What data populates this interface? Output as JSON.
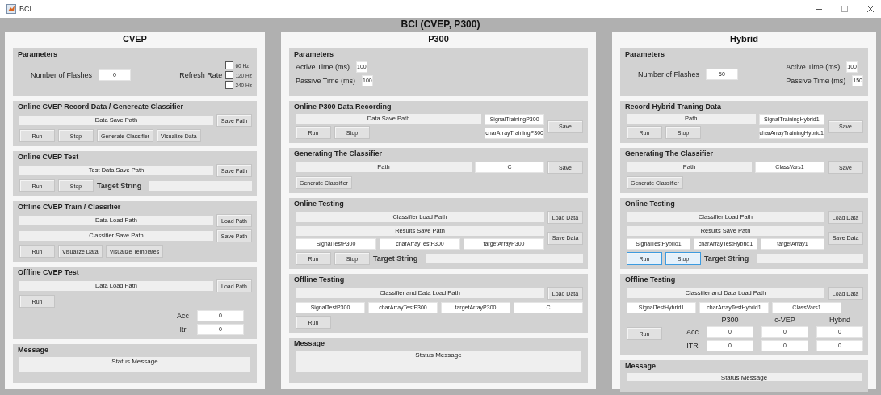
{
  "window": {
    "title": "BCI"
  },
  "header": "BCI (CVEP, P300)",
  "columns": [
    {
      "title": "CVEP",
      "panels": [
        {
          "kind": "params",
          "title": "Parameters",
          "lines": [
            [
              {
                "kind": "field",
                "label": "Number of Flashes",
                "value": "0"
              },
              {
                "kind": "checks",
                "label": "Refresh Rate",
                "options": [
                  {
                    "label": "60 Hz",
                    "checked": false
                  },
                  {
                    "label": "120 Hz",
                    "checked": false
                  },
                  {
                    "label": "240 Hz",
                    "checked": false
                  }
                ]
              }
            ]
          ]
        },
        {
          "kind": "form",
          "title": "Online CVEP Record Data / Genereate Classifier",
          "lines": [
            [
              {
                "kind": "path",
                "text": "Data Save Path"
              },
              {
                "kind": "button",
                "text": "Save Path",
                "highlighted": false
              }
            ],
            [
              {
                "kind": "button",
                "text": "Run",
                "highlighted": false
              },
              {
                "kind": "button",
                "text": "Stop",
                "highlighted": false
              },
              {
                "kind": "button",
                "text": "Generate Classifier",
                "highlighted": false
              },
              {
                "kind": "button",
                "text": "Visualize Data",
                "highlighted": false
              }
            ]
          ]
        },
        {
          "kind": "form",
          "title": "Online CVEP Test",
          "lines": [
            [
              {
                "kind": "path",
                "text": "Test Data Save Path"
              },
              {
                "kind": "button",
                "text": "Save Path",
                "highlighted": false
              }
            ],
            [
              {
                "kind": "button",
                "text": "Run",
                "highlighted": false
              },
              {
                "kind": "button",
                "text": "Stop",
                "highlighted": false
              },
              {
                "kind": "label",
                "text": "Target String"
              },
              {
                "kind": "input"
              }
            ]
          ]
        },
        {
          "kind": "form",
          "title": "Offline CVEP Train  / Classifier",
          "lines": [
            [
              {
                "kind": "path",
                "text": "Data Load Path"
              },
              {
                "kind": "button",
                "text": "Load Path",
                "highlighted": false
              }
            ],
            [
              {
                "kind": "path",
                "text": "Classifier Save Path"
              },
              {
                "kind": "button",
                "text": "Save Path",
                "highlighted": false
              }
            ],
            [
              {
                "kind": "button",
                "text": "Run",
                "highlighted": false
              },
              {
                "kind": "button",
                "text": "Visualize Data",
                "highlighted": false
              },
              {
                "kind": "button",
                "text": "Visualize Templates",
                "highlighted": false
              }
            ]
          ]
        },
        {
          "kind": "form",
          "title": "Offline CVEP Test",
          "lines": [
            [
              {
                "kind": "path",
                "text": "Data Load Path"
              },
              {
                "kind": "button",
                "text": "Load Path",
                "highlighted": false
              }
            ],
            [
              {
                "kind": "button",
                "text": "Run",
                "highlighted": false
              }
            ],
            [
              {
                "kind": "table",
                "rows": [
                  {
                    "label": "Acc",
                    "values": [
                      "0"
                    ]
                  },
                  {
                    "label": "Itr",
                    "values": [
                      "0"
                    ]
                  }
                ]
              }
            ]
          ]
        },
        {
          "kind": "message",
          "title": "Message",
          "text": "Status Message"
        }
      ]
    },
    {
      "title": "P300",
      "panels": [
        {
          "kind": "params",
          "title": "Parameters",
          "lines": [
            [
              {
                "kind": "stack",
                "lines": [
                  [
                    {
                      "kind": "field",
                      "label": "Active Time (ms)",
                      "value": "100"
                    }
                  ],
                  [
                    {
                      "kind": "field",
                      "label": "Passive Time (ms)",
                      "value": "100"
                    }
                  ]
                ]
              }
            ]
          ]
        },
        {
          "kind": "form",
          "title": "Online P300 Data Recording",
          "lines": [
            [
              {
                "kind": "stack",
                "lines": [
                  [
                    {
                      "kind": "path",
                      "text": "Data Save Path"
                    }
                  ],
                  [
                    {
                      "kind": "button",
                      "text": "Run",
                      "highlighted": false
                    },
                    {
                      "kind": "button",
                      "text": "Stop",
                      "highlighted": false
                    }
                  ]
                ]
              },
              {
                "kind": "stack",
                "lines": [
                  [
                    {
                      "kind": "value",
                      "text": "SignalTrainingP300"
                    }
                  ],
                  [
                    {
                      "kind": "value",
                      "text": "charArrayTrainingP300"
                    }
                  ]
                ]
              },
              {
                "kind": "button",
                "text": "Save",
                "highlighted": false
              }
            ]
          ]
        },
        {
          "kind": "form",
          "title": "Generating The Classifier",
          "lines": [
            [
              {
                "kind": "path",
                "text": "Path"
              },
              {
                "kind": "value",
                "text": "C"
              },
              {
                "kind": "button",
                "text": "Save",
                "highlighted": false
              }
            ],
            [
              {
                "kind": "button",
                "text": "Generate Classifier",
                "highlighted": false
              }
            ]
          ]
        },
        {
          "kind": "form",
          "title": "Online Testing",
          "lines": [
            [
              {
                "kind": "path",
                "text": "Classifier Load Path"
              },
              {
                "kind": "button",
                "text": "Load Data",
                "highlighted": false
              }
            ],
            [
              {
                "kind": "stack",
                "lines": [
                  [
                    {
                      "kind": "path",
                      "text": "Results Save Path"
                    }
                  ],
                  [
                    {
                      "kind": "value",
                      "text": "SignalTestP300"
                    },
                    {
                      "kind": "value",
                      "text": "charArrayTestP300"
                    },
                    {
                      "kind": "value",
                      "text": "targetArrayP300"
                    }
                  ]
                ]
              },
              {
                "kind": "button",
                "text": "Save Data",
                "highlighted": false
              }
            ],
            [
              {
                "kind": "button",
                "text": "Run",
                "highlighted": false
              },
              {
                "kind": "button",
                "text": "Stop",
                "highlighted": false
              },
              {
                "kind": "label",
                "text": "Target String"
              },
              {
                "kind": "input"
              }
            ]
          ]
        },
        {
          "kind": "form",
          "title": "Offline Testing",
          "lines": [
            [
              {
                "kind": "path",
                "text": "Classifier and Data Load Path"
              },
              {
                "kind": "button",
                "text": "Load Data",
                "highlighted": false
              }
            ],
            [
              {
                "kind": "value",
                "text": "SignalTestP300"
              },
              {
                "kind": "value",
                "text": "charArrayTestP300"
              },
              {
                "kind": "value",
                "text": "targetArrayP300"
              },
              {
                "kind": "value",
                "text": "C"
              }
            ],
            [
              {
                "kind": "button",
                "text": "Run",
                "highlighted": false
              }
            ]
          ]
        },
        {
          "kind": "message",
          "title": "Message",
          "text": "Status Message"
        }
      ]
    },
    {
      "title": "Hybrid",
      "panels": [
        {
          "kind": "params",
          "title": "Parameters",
          "lines": [
            [
              {
                "kind": "field",
                "label": "Number of Flashes",
                "value": "50"
              },
              {
                "kind": "stack",
                "lines": [
                  [
                    {
                      "kind": "field",
                      "label": "Active Time (ms)",
                      "value": "100"
                    }
                  ],
                  [
                    {
                      "kind": "field",
                      "label": "Passive Time (ms)",
                      "value": "150"
                    }
                  ]
                ]
              }
            ]
          ]
        },
        {
          "kind": "form",
          "title": "Record Hybrid Traning Data",
          "lines": [
            [
              {
                "kind": "stack",
                "lines": [
                  [
                    {
                      "kind": "path",
                      "text": "Path"
                    }
                  ],
                  [
                    {
                      "kind": "button",
                      "text": "Run",
                      "highlighted": false
                    },
                    {
                      "kind": "button",
                      "text": "Stop",
                      "highlighted": false
                    }
                  ]
                ]
              },
              {
                "kind": "stack",
                "lines": [
                  [
                    {
                      "kind": "value",
                      "text": "SignalTrainingHybrid1"
                    }
                  ],
                  [
                    {
                      "kind": "value",
                      "text": "charArrayTrainingHybrid1"
                    }
                  ]
                ]
              },
              {
                "kind": "button",
                "text": "Save",
                "highlighted": false
              }
            ]
          ]
        },
        {
          "kind": "form",
          "title": "Generating The Classifier",
          "lines": [
            [
              {
                "kind": "path",
                "text": "Path"
              },
              {
                "kind": "value",
                "text": "ClassVars1"
              },
              {
                "kind": "button",
                "text": "Save",
                "highlighted": false
              }
            ],
            [
              {
                "kind": "button",
                "text": "Generate Classifier",
                "highlighted": false
              }
            ]
          ]
        },
        {
          "kind": "form",
          "title": "Online Testing",
          "lines": [
            [
              {
                "kind": "path",
                "text": "Classifier Load Path"
              },
              {
                "kind": "button",
                "text": "Load Data",
                "highlighted": false
              }
            ],
            [
              {
                "kind": "stack",
                "lines": [
                  [
                    {
                      "kind": "path",
                      "text": "Results Save Path"
                    }
                  ],
                  [
                    {
                      "kind": "value",
                      "text": "SignalTestHybrid1"
                    },
                    {
                      "kind": "value",
                      "text": "charArrayTestHybrid1"
                    },
                    {
                      "kind": "value",
                      "text": "targetArray1"
                    }
                  ]
                ]
              },
              {
                "kind": "button",
                "text": "Save Data",
                "highlighted": false
              }
            ],
            [
              {
                "kind": "button",
                "text": "Run",
                "highlighted": true
              },
              {
                "kind": "button",
                "text": "Stop",
                "highlighted": true
              },
              {
                "kind": "label",
                "text": "Target String"
              },
              {
                "kind": "input"
              }
            ]
          ]
        },
        {
          "kind": "form",
          "title": "Offline Testing",
          "lines": [
            [
              {
                "kind": "path",
                "text": "Classifier and Data Load Path"
              },
              {
                "kind": "button",
                "text": "Load Data",
                "highlighted": false
              }
            ],
            [
              {
                "kind": "value",
                "text": "SignalTestHybrid1"
              },
              {
                "kind": "value",
                "text": "charArrayTestHybrid1"
              },
              {
                "kind": "value",
                "text": "ClassVars1"
              }
            ],
            [
              {
                "kind": "button",
                "text": "Run",
                "highlighted": false
              },
              {
                "kind": "table",
                "columns": [
                  "P300",
                  "c-VEP",
                  "Hybrid"
                ],
                "rows": [
                  {
                    "label": "Acc",
                    "values": [
                      "0",
                      "0",
                      "0"
                    ]
                  },
                  {
                    "label": "ITR",
                    "values": [
                      "0",
                      "0",
                      "0"
                    ]
                  }
                ]
              }
            ]
          ]
        },
        {
          "kind": "message",
          "title": "Message",
          "text": "Status Message"
        }
      ]
    }
  ]
}
